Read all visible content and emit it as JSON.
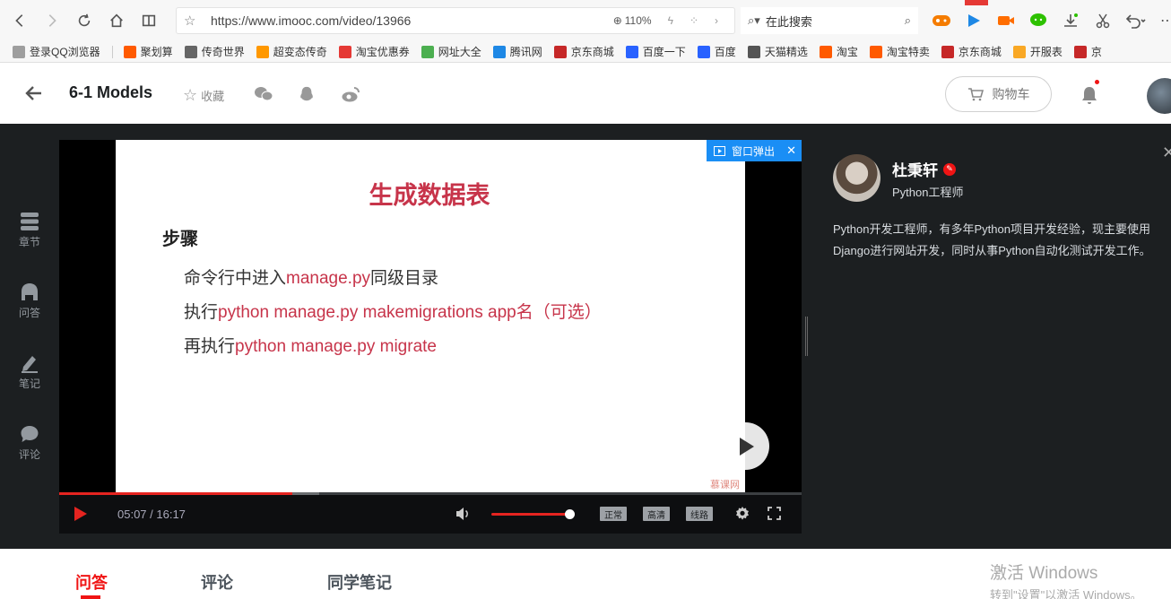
{
  "browser": {
    "url": "https://www.imooc.com/video/13966",
    "zoom": "110%",
    "search_placeholder": "在此搜索"
  },
  "bookmarks": [
    {
      "label": "登录QQ浏览器",
      "color": "#9e9e9e"
    },
    {
      "label": "聚划算",
      "color": "#ff5a00"
    },
    {
      "label": "传奇世界",
      "color": "#666666"
    },
    {
      "label": "超变态传奇",
      "color": "#ff9800"
    },
    {
      "label": "淘宝优惠券",
      "color": "#e53935"
    },
    {
      "label": "网址大全",
      "color": "#4caf50"
    },
    {
      "label": "腾讯网",
      "color": "#1e88e5"
    },
    {
      "label": "京东商城",
      "color": "#c62828"
    },
    {
      "label": "百度一下",
      "color": "#2962ff"
    },
    {
      "label": "百度",
      "color": "#2962ff"
    },
    {
      "label": "天猫精选",
      "color": "#555555"
    },
    {
      "label": "淘宝",
      "color": "#ff5a00"
    },
    {
      "label": "淘宝特卖",
      "color": "#ff5a00"
    },
    {
      "label": "京东商城",
      "color": "#c62828"
    },
    {
      "label": "开服表",
      "color": "#f9a825"
    },
    {
      "label": "京",
      "color": "#c62828"
    }
  ],
  "header": {
    "title": "6-1 Models",
    "collect_label": "收藏",
    "cart_label": "购物车"
  },
  "side_menu": [
    {
      "label": "章节",
      "icon": "chapter-icon"
    },
    {
      "label": "问答",
      "icon": "qa-icon"
    },
    {
      "label": "笔记",
      "icon": "note-icon"
    },
    {
      "label": "评论",
      "icon": "comment-icon"
    }
  ],
  "slide": {
    "title": "生成数据表",
    "heading": "步骤",
    "line1_pre": "命令行中进入",
    "line1_hl": "manage.py",
    "line1_post": "同级目录",
    "line2_pre": "执行",
    "line2_hl": "python manage.py makemigrations app名（可选）",
    "line3_pre": "再执行",
    "line3_hl": "python manage.py migrate",
    "watermark": "慕课网"
  },
  "player": {
    "popout_label": "窗口弹出",
    "current_time": "05:07",
    "duration": "16:17",
    "time_display": "05:07 / 16:17",
    "progress_fraction": 0.314,
    "buffer_fraction": 0.35,
    "volume_fraction": 0.97,
    "speed_label": "正常",
    "quality_label": "高清",
    "route_label": "线路"
  },
  "teacher": {
    "name": "杜秉轩",
    "role": "Python工程师",
    "description": "Python开发工程师，有多年Python项目开发经验，现主要使用Django进行网站开发，同时从事Python自动化测试开发工作。"
  },
  "tabs": [
    {
      "label": "问答",
      "active": true
    },
    {
      "label": "评论",
      "active": false
    },
    {
      "label": "同学笔记",
      "active": false
    }
  ],
  "activation": {
    "line1": "激活 Windows",
    "line2": "转到\"设置\"以激活 Windows。"
  },
  "colors": {
    "accent_red": "#f01414",
    "slide_red": "#c7344a",
    "popout_blue": "#1a8ef5",
    "dark_bg": "#1c1f21"
  }
}
